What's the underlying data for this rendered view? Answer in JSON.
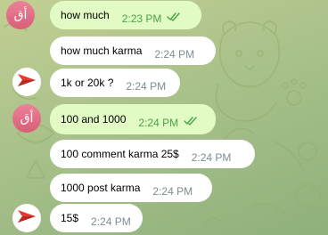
{
  "chat": {
    "messages": [
      {
        "direction": "outgoing",
        "avatar_text": "أق",
        "text": "how much",
        "time": "2:23 PM",
        "status_icon": "double-check-read"
      },
      {
        "direction": "incoming",
        "text": "how much karma",
        "time": "2:24 PM"
      },
      {
        "direction": "incoming",
        "avatar_icon": "red-arrow-logo",
        "text": "1k or 20k ?",
        "time": "2:24 PM"
      },
      {
        "direction": "outgoing",
        "avatar_text": "أق",
        "text": "100 and 1000",
        "time": "2:24 PM",
        "status_icon": "double-check-read"
      },
      {
        "direction": "incoming",
        "text": "100 comment karma 25$",
        "time": "2:24 PM"
      },
      {
        "direction": "incoming",
        "text": "1000 post karma",
        "time": "2:24 PM"
      },
      {
        "direction": "incoming",
        "avatar_icon": "red-arrow-logo",
        "text": "15$",
        "time": "2:24 PM"
      }
    ]
  },
  "colors": {
    "outgoing_bubble": "#e2fbc5",
    "incoming_bubble": "#ffffff",
    "outgoing_time": "#4aa147",
    "incoming_time": "#7e8c93",
    "avatar_pink": "#e27089",
    "avatar_logo_red": "#e6392f"
  }
}
